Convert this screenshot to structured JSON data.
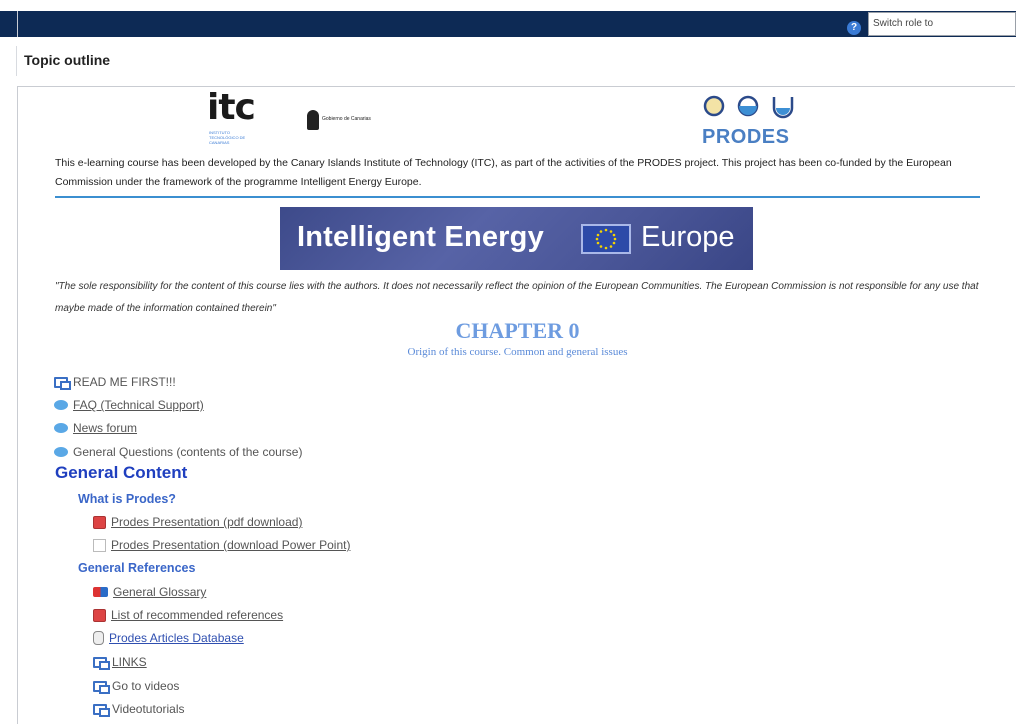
{
  "header": {
    "help_icon": "?",
    "switch_role_label": "Switch role to"
  },
  "page": {
    "title": "Topic outline"
  },
  "logos": {
    "itc_text": "itc",
    "itc_subtext": "INSTITUTO TECNOLÓGICO DE CANARIAS",
    "gobierno_text": "Gobierno de Canarias",
    "prodes_text": "PRODES"
  },
  "intro": {
    "text": "This e-learning course has been developed by the Canary Islands Institute of Technology (ITC), as part of the activities of the PRODES project. This project has been co-funded by the European Commission under the framework of the programme Intelligent Energy Europe."
  },
  "banner": {
    "left_text": "Intelligent Energy",
    "right_text": "Europe"
  },
  "disclaimer": {
    "text": "\"The sole responsibility for the content of this course lies with the authors. It does not necessarily reflect the opinion of the European Communities. The European Commission is not responsible for any use that maybe made of the information contained therein\""
  },
  "chapter": {
    "title": "CHAPTER 0",
    "subtitle": "Origin of this course. Common and general issues"
  },
  "items": {
    "read_me": "READ ME FIRST!!!",
    "faq": "FAQ (Technical Support)",
    "news": "News forum",
    "general_questions": "General Questions (contents of the course)"
  },
  "general_content": {
    "heading": "General Content",
    "what_is_prodes": "What is Prodes?",
    "presentation_pdf": "Prodes Presentation (pdf download)",
    "presentation_ppt": "Prodes Presentation (download Power Point)",
    "general_references": "General References",
    "glossary": "General Glossary",
    "recommended_refs": "List of recommended references",
    "articles_db": "Prodes Articles Database",
    "links": "LINKS",
    "go_to_videos": "Go to videos",
    "videotutorials": "Videotutorials"
  },
  "colors": {
    "topbar": "#0d2a55",
    "chapter": "#6e9ce0",
    "general_content": "#1f3fbf",
    "prodes_blue": "#4a7fc3"
  }
}
